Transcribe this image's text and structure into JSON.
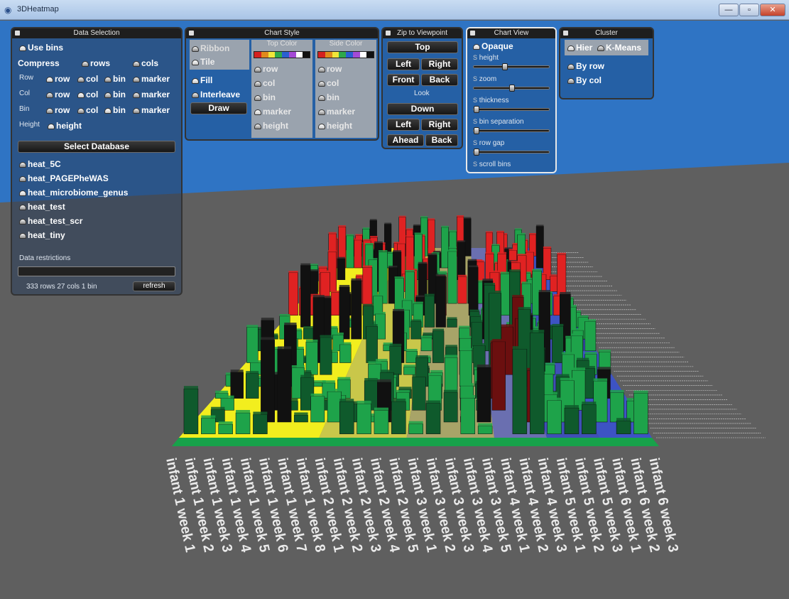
{
  "window": {
    "title": "3DHeatmap",
    "app_icon": "heatmap-app-icon",
    "buttons": [
      "minimize",
      "maximize",
      "close"
    ],
    "close_glyph": "✕"
  },
  "data_selection": {
    "header": "Data Selection",
    "use_bins": "Use bins",
    "compress_label": "Compress",
    "compress_rows": "rows",
    "compress_cols": "cols",
    "row_label": "Row",
    "col_label": "Col",
    "bin_label": "Bin",
    "height_label": "Height",
    "opt_row": "row",
    "opt_col": "col",
    "opt_bin": "bin",
    "opt_marker": "marker",
    "opt_height": "height",
    "select_db": "Select Database",
    "databases": [
      "heat_5C",
      "heat_PAGEPheWAS",
      "heat_microbiome_genus",
      "heat_test",
      "heat_test_scr",
      "heat_tiny"
    ],
    "restrictions_label": "Data restrictions",
    "restrictions_value": "",
    "summary": "333 rows  27 cols  1 bin",
    "refresh": "refresh"
  },
  "chart_style": {
    "header": "Chart Style",
    "ribbon": "Ribbon",
    "tile": "Tile",
    "fill": "Fill",
    "interleave": "Interleave",
    "draw": "Draw",
    "top_color_header": "Top Color",
    "side_color_header": "Side Color",
    "color_opts": [
      "row",
      "col",
      "bin",
      "marker",
      "height"
    ],
    "ramp_colors": [
      "#d42020",
      "#e08a1c",
      "#f1e63a",
      "#2fa84a",
      "#2a5fd0",
      "#a44ad6",
      "#ffffff",
      "#111111"
    ]
  },
  "zip": {
    "header": "Zip to Viewpoint",
    "top": "Top",
    "left": "Left",
    "right": "Right",
    "front": "Front",
    "back": "Back",
    "look": "Look",
    "down": "Down",
    "left2": "Left",
    "right2": "Right",
    "ahead": "Ahead",
    "back2": "Back"
  },
  "chart_view": {
    "header": "Chart View",
    "opaque": "Opaque",
    "sliders": [
      {
        "label": "height",
        "value": 0.4
      },
      {
        "label": "zoom",
        "value": 0.5
      },
      {
        "label": "thickness",
        "value": 0.0
      },
      {
        "label": "bin separation",
        "value": 0.0
      },
      {
        "label": "row gap",
        "value": 0.0
      },
      {
        "label": "scroll bins",
        "value": null
      }
    ]
  },
  "cluster": {
    "header": "Cluster",
    "hier": "Hier",
    "kmeans": "K-Means",
    "by_row": "By row",
    "by_col": "By col"
  },
  "chart_data": {
    "type": "3d-heatmap",
    "columns": [
      "infant 1 week 1",
      "infant 1 week 2",
      "infant 1 week 3",
      "infant 1 week 4",
      "infant 1 week 5",
      "infant 1 week 6",
      "infant 1 week 7",
      "infant 1 week 8",
      "infant 2 week 1",
      "infant 2 week 2",
      "infant 2 week 3",
      "infant 2 week 4",
      "infant 2 week 5",
      "infant 3 week 1",
      "infant 3 week 2",
      "infant 3 week 3",
      "infant 3 week 4",
      "infant 3 week 5",
      "infant 4 week 1",
      "infant 4 week 2",
      "infant 4 week 3",
      "infant 5 week 1",
      "infant 5 week 2",
      "infant 5 week 3",
      "infant 6 week 1",
      "infant 6 week 2",
      "infant 6 week 3"
    ],
    "group_floor_colors": {
      "infant 1": "#f2ee1e",
      "infant 2": "#c9c74a",
      "infant 3": "#a8a468",
      "infant 4": "#6a6fb0",
      "infant 5": "#3f4fb6",
      "infant 6": "#3d53c4"
    },
    "bar_colors": [
      "#1ea34a",
      "#0f5a2c",
      "#111111",
      "#e02222",
      "#6b0f0f"
    ]
  }
}
